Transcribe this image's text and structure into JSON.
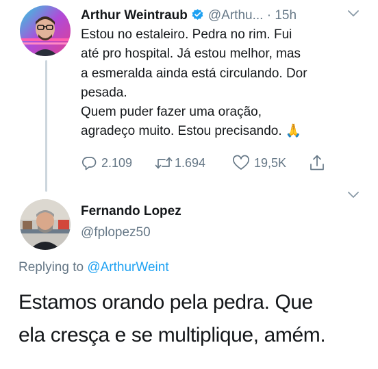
{
  "tweet": {
    "author_name": "Arthur Weintraub",
    "author_handle": "@Arthu...",
    "separator": "·",
    "time": "15h",
    "text_lines": [
      "Estou no estaleiro. Pedra no rim. Fui",
      "até pro hospital. Já estou melhor, mas",
      "a esmeralda ainda está circulando. Dor",
      "pesada.",
      "Quem puder fazer uma oração,",
      "agradeço muito. Estou precisando."
    ],
    "emoji": "🙏",
    "replies": "2.109",
    "retweets": "1.694",
    "likes": "19,5K",
    "verified_color": "#1da1f2"
  },
  "reply": {
    "author_name": "Fernando Lopez",
    "author_handle": "@fplopez50",
    "replying_prefix": "Replying to",
    "replying_to": "@ArthurWeint",
    "text_lines": [
      "Estamos orando pela pedra. Que",
      "ela cresça e se multiplique, amém."
    ]
  },
  "icons": {
    "reply": "reply-icon",
    "retweet": "retweet-icon",
    "like": "heart-icon",
    "share": "share-icon",
    "more": "chevron-down-icon",
    "verified": "verified-badge-icon"
  }
}
